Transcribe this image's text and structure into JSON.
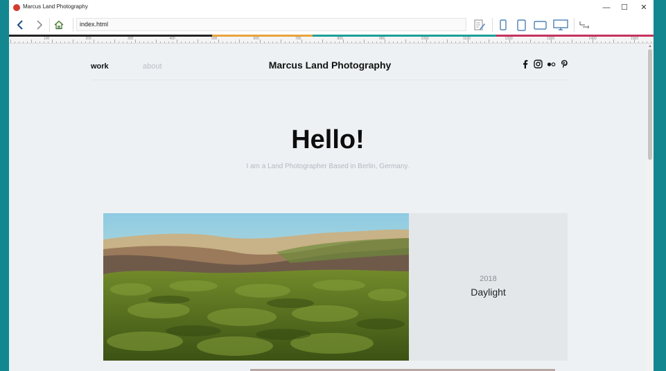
{
  "window": {
    "title": "Marcus Land Photography",
    "minimize": "—",
    "maximize": "☐",
    "close": "✕"
  },
  "toolbar": {
    "url": "index.html",
    "icons": [
      "back-icon",
      "forward-icon",
      "home-icon",
      "edit-icon",
      "phone-icon",
      "tablet-icon",
      "tablet-landscape-icon",
      "desktop-icon",
      "resize-icon"
    ]
  },
  "ruler": {
    "labels": [
      "100",
      "200",
      "300",
      "400",
      "500",
      "600",
      "700",
      "800",
      "900",
      "1000",
      "1100",
      "1200",
      "1300",
      "1400",
      "1500"
    ]
  },
  "colors": {
    "breakpoint_black": "#222222",
    "breakpoint_orange": "#e8a33c",
    "breakpoint_teal": "#1a9f98",
    "breakpoint_magenta": "#c7305f",
    "page_bg": "#edf1f4",
    "card_bg": "#e3e7ea"
  },
  "site": {
    "nav": {
      "work": "work",
      "about": "about",
      "brand": "Marcus Land Photography",
      "social_icons": [
        "facebook-icon",
        "instagram-icon",
        "flickr-icon",
        "pinterest-icon"
      ]
    },
    "hero": {
      "title": "Hello!",
      "subtitle": "I am a Land Photographer Based in Berlin, Germany."
    },
    "project": {
      "year": "2018",
      "title": "Daylight"
    }
  }
}
